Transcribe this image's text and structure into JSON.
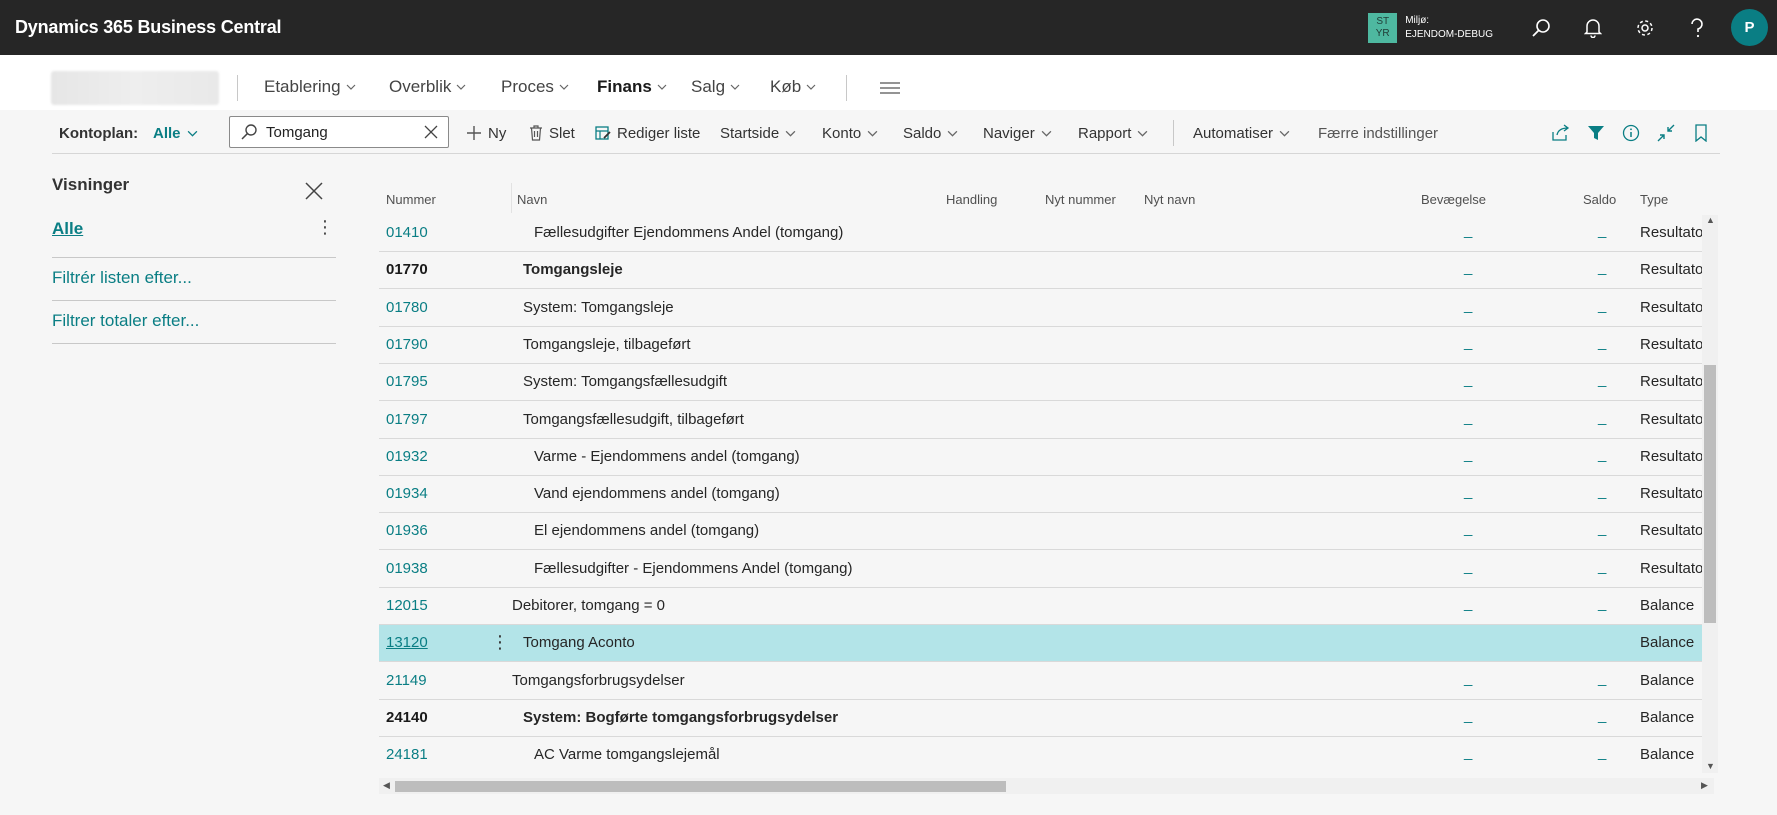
{
  "app": {
    "title": "Dynamics 365 Business Central",
    "env_badge_top": "ST",
    "env_badge_bottom": "YR",
    "env_label": "Miljø:",
    "env_name": "EJENDOM-DEBUG",
    "avatar_initial": "P",
    "accent_color": "#0a7e84"
  },
  "nav": {
    "items": [
      "Etablering",
      "Overblik",
      "Proces",
      "Finans",
      "Salg",
      "Køb"
    ],
    "active": "Finans"
  },
  "actions": {
    "kontoplan_label": "Kontoplan:",
    "kontoplan_value": "Alle",
    "search_value": "Tomgang",
    "new": "Ny",
    "delete": "Slet",
    "edit_list": "Rediger liste",
    "startside": "Startside",
    "konto": "Konto",
    "saldo": "Saldo",
    "naviger": "Naviger",
    "rapport": "Rapport",
    "automatiser": "Automatiser",
    "fewer_settings": "Færre indstillinger"
  },
  "views": {
    "title": "Visninger",
    "all": "Alle",
    "filter_list": "Filtrér listen efter...",
    "filter_totals": "Filtrer totaler efter..."
  },
  "grid": {
    "headers": {
      "nummer": "Nummer",
      "navn": "Navn",
      "handling": "Handling",
      "nyt_nummer": "Nyt nummer",
      "nyt_navn": "Nyt navn",
      "bevaegelse": "Bevægelse",
      "saldo": "Saldo",
      "type": "Type"
    },
    "rows": [
      {
        "number": "01410",
        "name": "Fællesudgifter Ejendommens Andel (tomgang)",
        "indent": 2,
        "bold": false,
        "bevaegelse": "_",
        "saldo": "_",
        "type": "Resultatop"
      },
      {
        "number": "01770",
        "name": "Tomgangsleje",
        "indent": 1,
        "bold": true,
        "bevaegelse": "_",
        "saldo": "_",
        "type": "Resultatop"
      },
      {
        "number": "01780",
        "name": "System: Tomgangsleje",
        "indent": 1,
        "bold": false,
        "bevaegelse": "_",
        "saldo": "_",
        "type": "Resultatop"
      },
      {
        "number": "01790",
        "name": "Tomgangsleje, tilbageført",
        "indent": 1,
        "bold": false,
        "bevaegelse": "_",
        "saldo": "_",
        "type": "Resultatop"
      },
      {
        "number": "01795",
        "name": "System: Tomgangsfællesudgift",
        "indent": 1,
        "bold": false,
        "bevaegelse": "_",
        "saldo": "_",
        "type": "Resultatop"
      },
      {
        "number": "01797",
        "name": "Tomgangsfællesudgift, tilbageført",
        "indent": 1,
        "bold": false,
        "bevaegelse": "_",
        "saldo": "_",
        "type": "Resultatop"
      },
      {
        "number": "01932",
        "name": "Varme - Ejendommens andel (tomgang)",
        "indent": 2,
        "bold": false,
        "bevaegelse": "_",
        "saldo": "_",
        "type": "Resultatop"
      },
      {
        "number": "01934",
        "name": "Vand ejendommens andel (tomgang)",
        "indent": 2,
        "bold": false,
        "bevaegelse": "_",
        "saldo": "_",
        "type": "Resultatop"
      },
      {
        "number": "01936",
        "name": "El ejendommens andel (tomgang)",
        "indent": 2,
        "bold": false,
        "bevaegelse": "_",
        "saldo": "_",
        "type": "Resultatop"
      },
      {
        "number": "01938",
        "name": "Fællesudgifter - Ejendommens Andel (tomgang)",
        "indent": 2,
        "bold": false,
        "bevaegelse": "_",
        "saldo": "_",
        "type": "Resultatop"
      },
      {
        "number": "12015",
        "name": "Debitorer, tomgang = 0",
        "indent": 0,
        "bold": false,
        "bevaegelse": "_",
        "saldo": "_",
        "type": "Balance"
      },
      {
        "number": "13120",
        "name": "Tomgang Aconto",
        "indent": 1,
        "bold": false,
        "bevaegelse": "",
        "saldo": "",
        "type": "Balance",
        "selected": true
      },
      {
        "number": "21149",
        "name": "Tomgangsforbrugsydelser",
        "indent": 0,
        "bold": false,
        "bevaegelse": "_",
        "saldo": "_",
        "type": "Balance"
      },
      {
        "number": "24140",
        "name": "System: Bogførte tomgangsforbrugsydelser",
        "indent": 1,
        "bold": true,
        "bevaegelse": "_",
        "saldo": "_",
        "type": "Balance"
      },
      {
        "number": "24181",
        "name": "AC Varme tomgangslejemål",
        "indent": 2,
        "bold": false,
        "bevaegelse": "_",
        "saldo": "_",
        "type": "Balance"
      }
    ]
  }
}
